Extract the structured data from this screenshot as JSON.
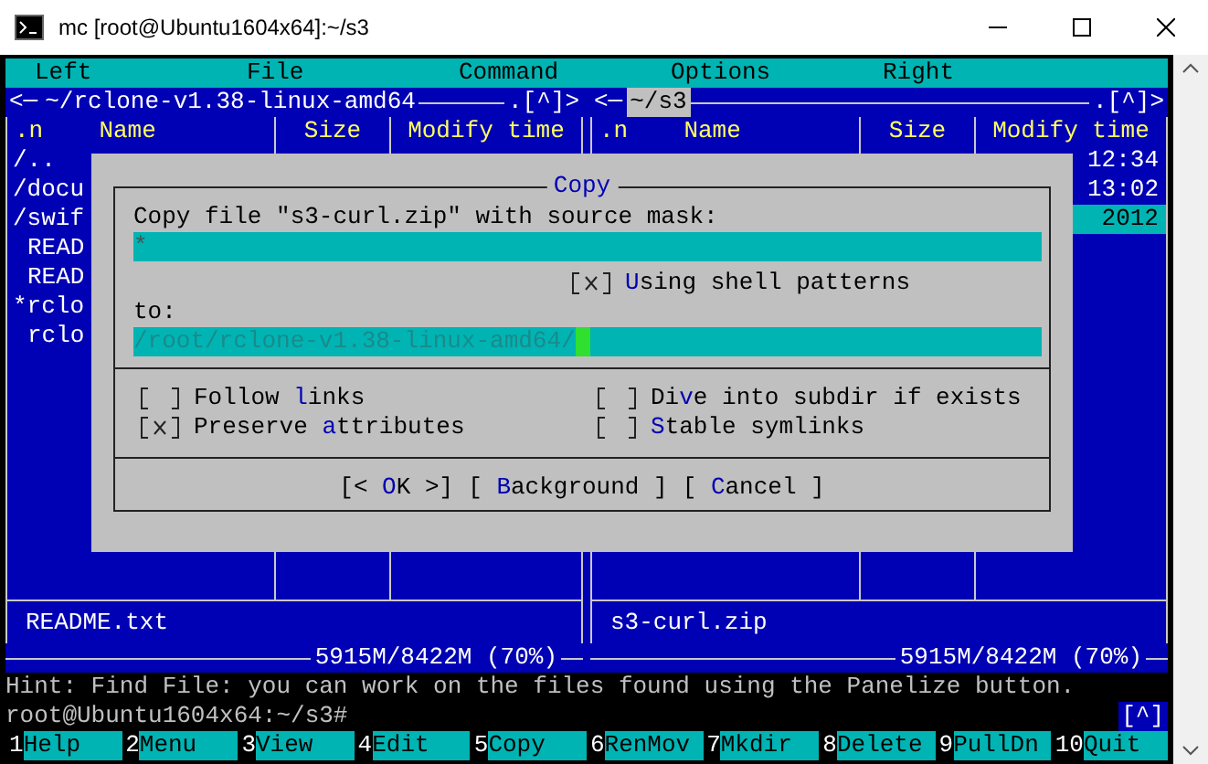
{
  "window": {
    "title": "mc [root@Ubuntu1604x64]:~/s3"
  },
  "menu": [
    "Left",
    "File",
    "Command",
    "Options",
    "Right"
  ],
  "panels": [
    {
      "left_mark": "<─",
      "path": "~/rclone-v1.38-linux-amd64",
      "right_mark": ".[^]>",
      "active": false,
      "columns": {
        "sort": ".n",
        "name": "Name",
        "size": "Size",
        "time": "Modify time"
      },
      "rows": [
        {
          "name": "/..",
          "kind": "dir"
        },
        {
          "name": "/docu",
          "kind": "dir"
        },
        {
          "name": "/swif",
          "kind": "dir"
        },
        {
          "name": "READ",
          "kind": "file"
        },
        {
          "name": "READ",
          "kind": "file"
        },
        {
          "name": "*rclo",
          "kind": "exec"
        },
        {
          "name": "rclo",
          "kind": "file"
        }
      ],
      "status_file": "README.txt",
      "disk": "5915M/8422M (70%)"
    },
    {
      "left_mark": "<─",
      "path": "~/s3",
      "right_mark": ".[^]>",
      "active": true,
      "columns": {
        "sort": ".n",
        "name": "Name",
        "size": "Size",
        "time": "Modify time"
      },
      "rows": [
        {
          "time": "12:34",
          "selected": false
        },
        {
          "time": "13:02",
          "selected": false
        },
        {
          "time": "2012",
          "selected": true
        }
      ],
      "status_file": "s3-curl.zip",
      "disk": "5915M/8422M (70%)"
    }
  ],
  "dialog": {
    "title": "Copy",
    "source_label": "Copy file \"s3-curl.zip\" with source mask:",
    "source_value": "*",
    "shell_patterns": {
      "checked": true,
      "hotkey": "U",
      "after": "sing shell patterns"
    },
    "target_label": "to:",
    "target_value": "/root/rclone-v1.38-linux-amd64/",
    "options": [
      {
        "checked": false,
        "before": "Follow ",
        "hotkey": "l",
        "after": "inks"
      },
      {
        "checked": false,
        "before": "Di",
        "hotkey": "v",
        "after": "e into subdir if exists"
      },
      {
        "checked": true,
        "before": "Preserve ",
        "hotkey": "a",
        "after": "ttributes"
      },
      {
        "checked": false,
        "hotkey": "S",
        "after": "table symlinks"
      }
    ],
    "buttons": [
      {
        "before": "[< ",
        "hotkey": "O",
        "after": "K >]"
      },
      {
        "before": "[ ",
        "hotkey": "B",
        "after": "ackground ]"
      },
      {
        "before": "[ ",
        "hotkey": "C",
        "after": "ancel ]"
      }
    ]
  },
  "hint": "Hint: Find File: you can work on the files found using the Panelize button.",
  "prompt": "root@Ubuntu1604x64:~/s3#",
  "prompt_mark": "[^]",
  "fkeys": [
    {
      "key": "1",
      "label": "Help"
    },
    {
      "key": "2",
      "label": "Menu"
    },
    {
      "key": "3",
      "label": "View"
    },
    {
      "key": "4",
      "label": "Edit"
    },
    {
      "key": "5",
      "label": "Copy"
    },
    {
      "key": "6",
      "label": "RenMov"
    },
    {
      "key": "7",
      "label": "Mkdir"
    },
    {
      "key": "8",
      "label": "Delete"
    },
    {
      "key": "9",
      "label": "PullDn"
    },
    {
      "key": "10",
      "label": "Quit"
    }
  ]
}
